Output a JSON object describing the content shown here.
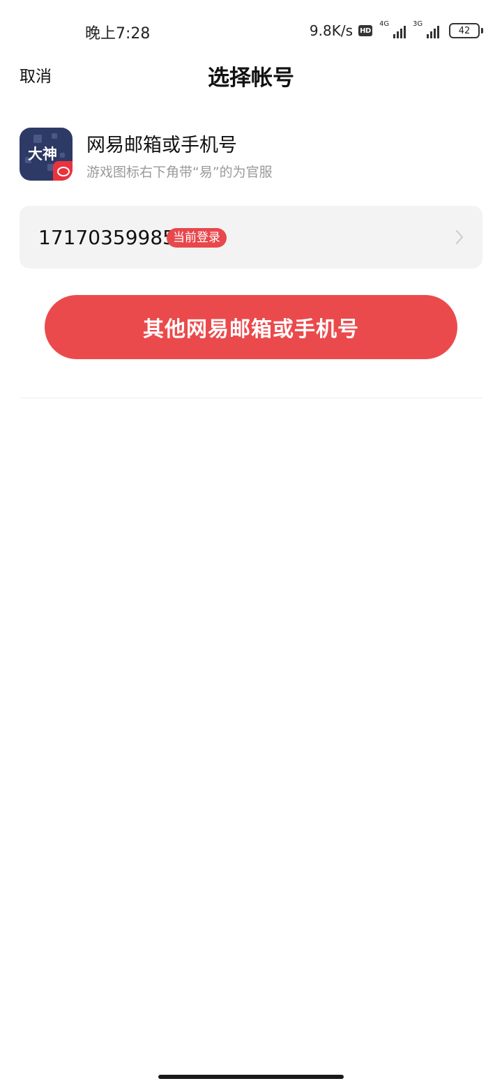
{
  "status_bar": {
    "time": "晚上7:28",
    "net_speed": "9.8K/s",
    "hd": "HD",
    "signal1_gen": "4G",
    "signal2_gen": "3G",
    "battery": "42"
  },
  "header": {
    "cancel_label": "取消",
    "title": "选择帐号"
  },
  "app": {
    "icon_text": "大神",
    "name": "网易邮箱或手机号",
    "hint": "游戏图标右下角带“易”的为官服"
  },
  "account": {
    "number": "17170359985",
    "badge": "当前登录"
  },
  "actions": {
    "other_account_label": "其他网易邮箱或手机号"
  },
  "colors": {
    "accent": "#eb4a4c",
    "card_bg": "#f3f3f3",
    "hint_text": "#9a9a9a"
  }
}
